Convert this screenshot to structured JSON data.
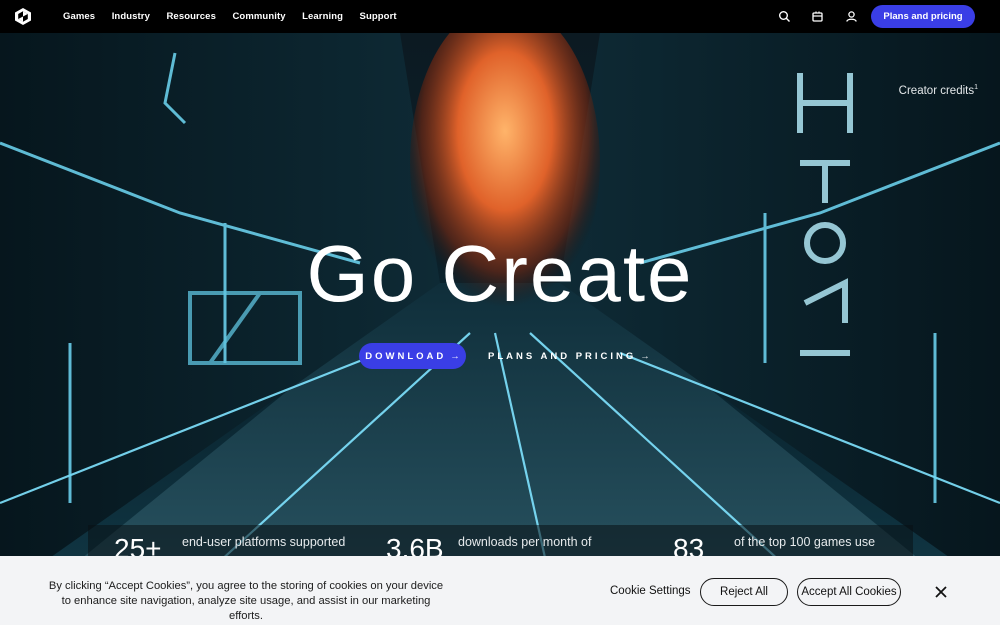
{
  "nav": {
    "links": [
      "Games",
      "Industry",
      "Resources",
      "Community",
      "Learning",
      "Support"
    ],
    "icons": [
      "search-icon",
      "cart-icon",
      "account-icon"
    ],
    "plans_button": "Plans and pricing"
  },
  "hero": {
    "credits": "Creator credits",
    "credits_sup": "1",
    "title": "Go Create",
    "download_label": "DOWNLOAD",
    "plans_label": "PLANS AND PRICING",
    "arrow": "→"
  },
  "stats": [
    {
      "number": "25+",
      "text": "end-user platforms supported"
    },
    {
      "number": "3.6B",
      "text": "downloads per month of"
    },
    {
      "number": "83",
      "text": "of the top 100 games use"
    }
  ],
  "cookie": {
    "text": "By clicking “Accept Cookies”, you agree to the storing of cookies on your device to enhance site navigation, analyze site usage, and assist in our marketing efforts.",
    "settings": "Cookie Settings",
    "reject": "Reject All",
    "accept": "Accept All Cookies"
  },
  "colors": {
    "accent": "#3a3ee6",
    "nav_bg": "#000000",
    "banner_bg": "#f3f4f6"
  }
}
